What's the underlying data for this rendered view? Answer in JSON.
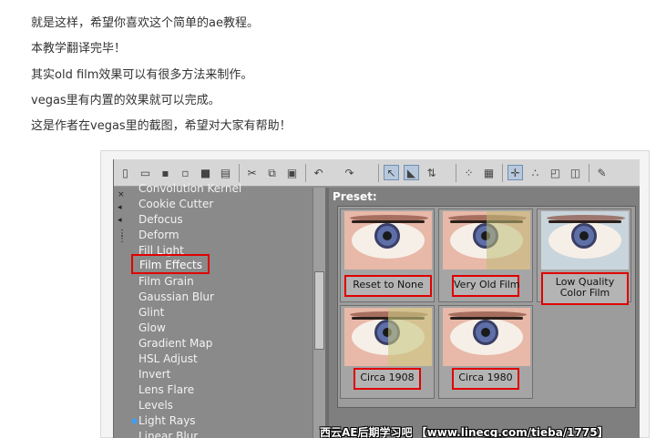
{
  "article": {
    "lines": [
      "就是这样，希望你喜欢这个简单的ae教程。",
      "本教学翻译完毕！",
      "其实old film效果可以有很多方法来制作。",
      "vegas里有内置的效果就可以完成。",
      "这是作者在vegas里的截图，希望对大家有帮助！"
    ]
  },
  "screenshot": {
    "toolbar": {
      "icons": [
        "new-file-icon",
        "open-folder-icon",
        "save-icon",
        "save-as-icon",
        "render-icon",
        "properties-icon",
        "cut-icon",
        "copy-icon",
        "paste-icon",
        "undo-icon",
        "redo-icon",
        "normal-edit-tool-icon",
        "envelope-tool-icon",
        "selection-tool-icon",
        "snap-icon",
        "marker-icon",
        "auto-ripple-icon",
        "enable-snapping-icon",
        "lock-icon",
        "crop-icon",
        "brush-icon"
      ]
    },
    "effects_list": {
      "items": [
        "Convolution Kernel",
        "Cookie Cutter",
        "Defocus",
        "Deform",
        "Fill Light",
        "Film Effects",
        "Film Grain",
        "Gaussian Blur",
        "Glint",
        "Glow",
        "Gradient Map",
        "HSL Adjust",
        "Invert",
        "Lens Flare",
        "Levels",
        "Light Rays",
        "Linear Blur"
      ],
      "selected": "Film Effects"
    },
    "preset_panel": {
      "label": "Preset:",
      "presets": [
        "Reset to None",
        "Very Old Film",
        "Low Quality Color Film",
        "Circa 1908",
        "Circa 1980"
      ]
    },
    "watermark": "西云AE后期学习吧 【www.linecg.com/tieba/1775】"
  },
  "colors": {
    "highlight_border": "#e00000",
    "panel_bg": "#8c8c8c",
    "text_light": "#f2f2f2"
  }
}
